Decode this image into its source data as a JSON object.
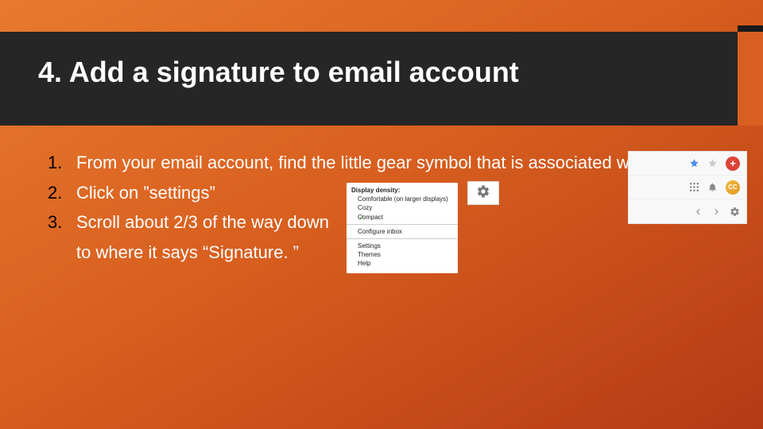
{
  "title": "4.  Add a signature to email account",
  "steps": {
    "num1": "1.",
    "text1": "From your email account, find the little gear symbol that is associated with “settings”",
    "num2": "2.",
    "text2": "Click on ”settings”",
    "num3": "3.",
    "text3": "Scroll about 2/3 of the way down",
    "text3b": "to where it says “Signature. ”"
  },
  "menu_popup": {
    "header": "Display density:",
    "opt1": "Comfortable (on larger displays)",
    "opt2": "Cozy",
    "opt3": "Compact",
    "item1": "Configure inbox",
    "item2": "Settings",
    "item3": "Themes",
    "item4": "Help"
  },
  "toolbar": {
    "avatar_initials": "CC",
    "plus_label": "+"
  }
}
